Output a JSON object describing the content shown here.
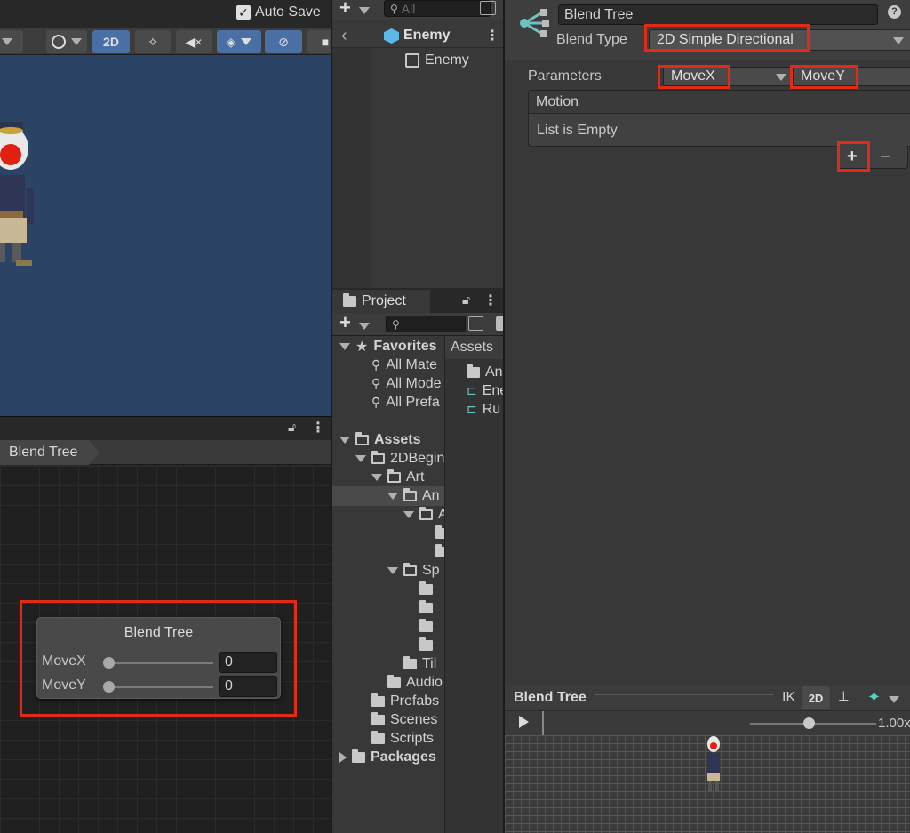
{
  "scene_toolbar": {
    "auto_save_label": "Auto Save",
    "auto_save_checked": true,
    "mode_2d_label": "2D"
  },
  "hierarchy": {
    "search_placeholder": "All",
    "breadcrumb_root": "Enemy",
    "child": "Enemy"
  },
  "project": {
    "tab_label": "Project",
    "favorites_label": "Favorites",
    "favorites": [
      "All Mate",
      "All Mode",
      "All Prefa"
    ],
    "assets_label": "Assets",
    "tree": [
      "2DBegin",
      "Art",
      "An",
      "A",
      "Sp",
      "Til",
      "Audio",
      "Prefabs",
      "Scenes",
      "Scripts"
    ],
    "packages_label": "Packages",
    "right_header": "Assets",
    "right_items": [
      "An",
      "Ene",
      "Ru"
    ]
  },
  "animator": {
    "breadcrumb": "Blend Tree",
    "node": {
      "title": "Blend Tree",
      "params": [
        {
          "name": "MoveX",
          "value": "0"
        },
        {
          "name": "MoveY",
          "value": "0"
        }
      ]
    }
  },
  "inspector": {
    "name_value": "Blend Tree",
    "blend_type_label": "Blend Type",
    "blend_type_value": "2D Simple Directional",
    "parameters_label": "Parameters",
    "param_x": "MoveX",
    "param_y": "MoveY",
    "motion_header": "Motion",
    "list_empty": "List is Empty",
    "add_label": "+",
    "remove_label": "–"
  },
  "preview": {
    "title": "Blend Tree",
    "ik_label": "IK",
    "mode_2d_label": "2D",
    "speed": "1.00x"
  },
  "colors": {
    "highlight": "#e12b16",
    "scene_bg": "#2b4466",
    "accent_blue": "#4a6fa5"
  }
}
